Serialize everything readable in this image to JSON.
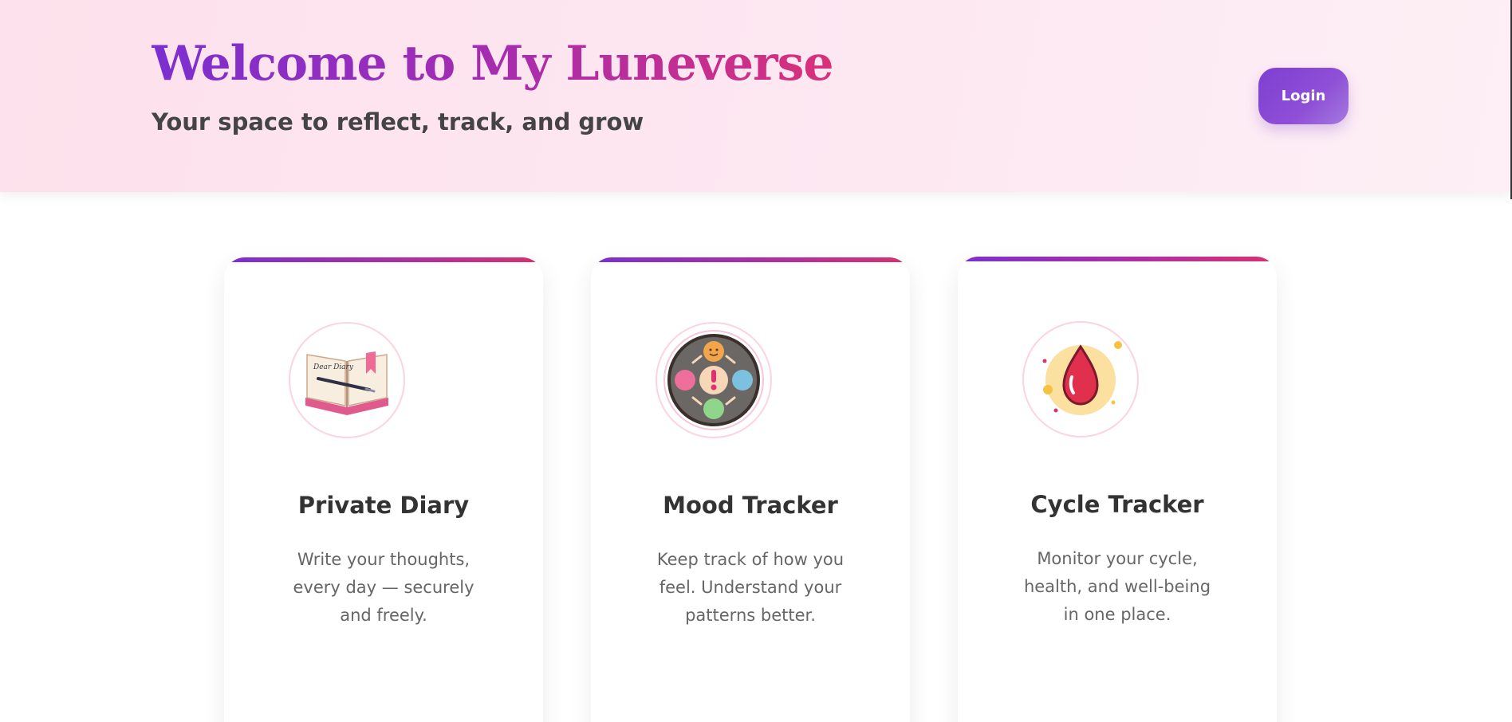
{
  "header": {
    "title": "Welcome to My Luneverse",
    "subtitle": "Your space to reflect, track, and grow",
    "login_label": "Login"
  },
  "colors": {
    "accent_purple": "#7e3fd2",
    "accent_pink": "#d9306e",
    "header_background": "#fde1ec"
  },
  "cards": [
    {
      "title": "Private Diary",
      "description": "Write your thoughts, every day — securely and freely.",
      "icon": "diary-book-icon",
      "icon_text": "Dear Diary"
    },
    {
      "title": "Mood Tracker",
      "description": "Keep track of how you feel. Understand your patterns better.",
      "icon": "mood-cycle-icon"
    },
    {
      "title": "Cycle Tracker",
      "description": "Monitor your cycle, health, and well-being in one place.",
      "icon": "blood-drop-icon"
    }
  ]
}
